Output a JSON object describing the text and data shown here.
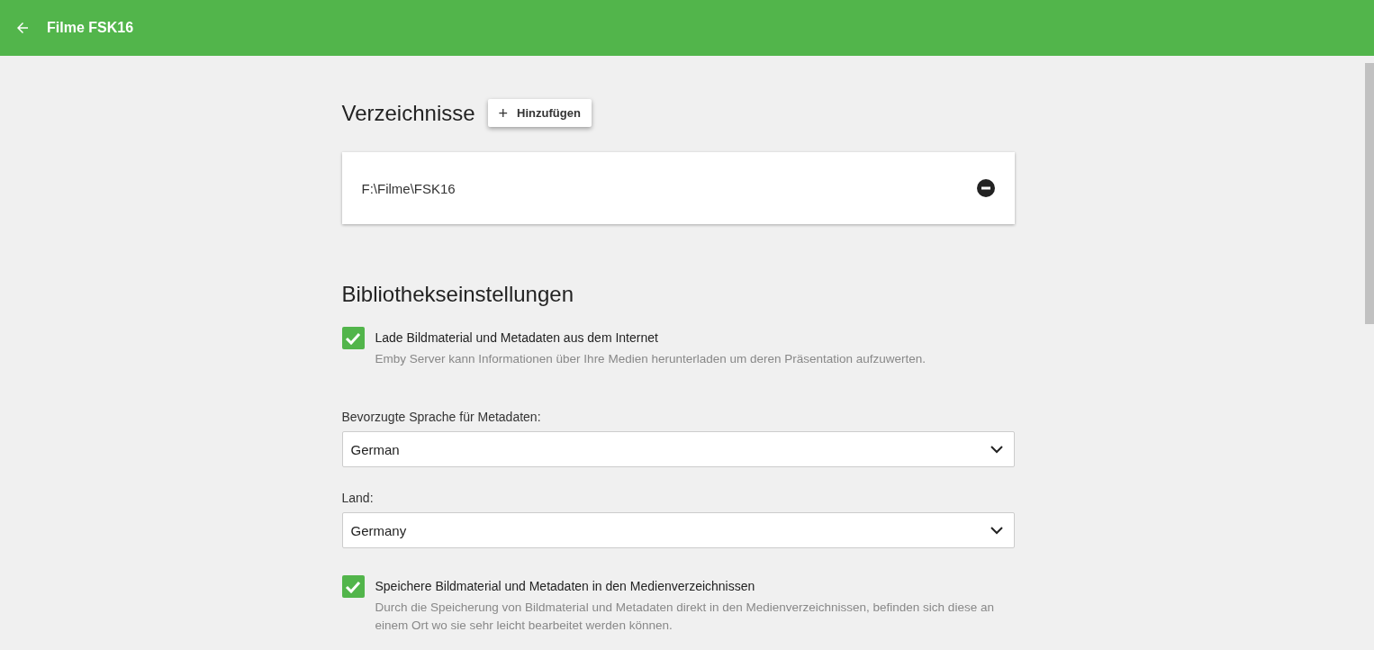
{
  "header": {
    "title": "Filme FSK16"
  },
  "folders": {
    "title": "Verzeichnisse",
    "add_button": {
      "icon": "+",
      "label": "Hinzufügen"
    },
    "items": [
      {
        "path": "F:\\Filme\\FSK16"
      }
    ]
  },
  "library_settings": {
    "title": "Bibliothekseinstellungen",
    "items": [
      {
        "kind": "checkbox",
        "label": "Lade Bildmaterial und Metadaten aus dem Internet",
        "checked": true,
        "description": "Emby Server kann Informationen über Ihre Medien herunterladen um deren Präsentation aufzuwerten."
      },
      {
        "kind": "select",
        "label": "Bevorzugte Sprache für Metadaten:",
        "value": "German"
      },
      {
        "kind": "select",
        "label": "Land:",
        "value": "Germany"
      },
      {
        "kind": "checkbox",
        "label": "Speichere Bildmaterial und Metadaten in den Medienverzeichnissen",
        "checked": true,
        "description": "Durch die Speicherung von Bildmaterial und Metadaten direkt in den Medienverzeichnissen, befinden sich diese an einem Ort wo sie sehr leicht bearbeitet werden können."
      }
    ]
  }
}
